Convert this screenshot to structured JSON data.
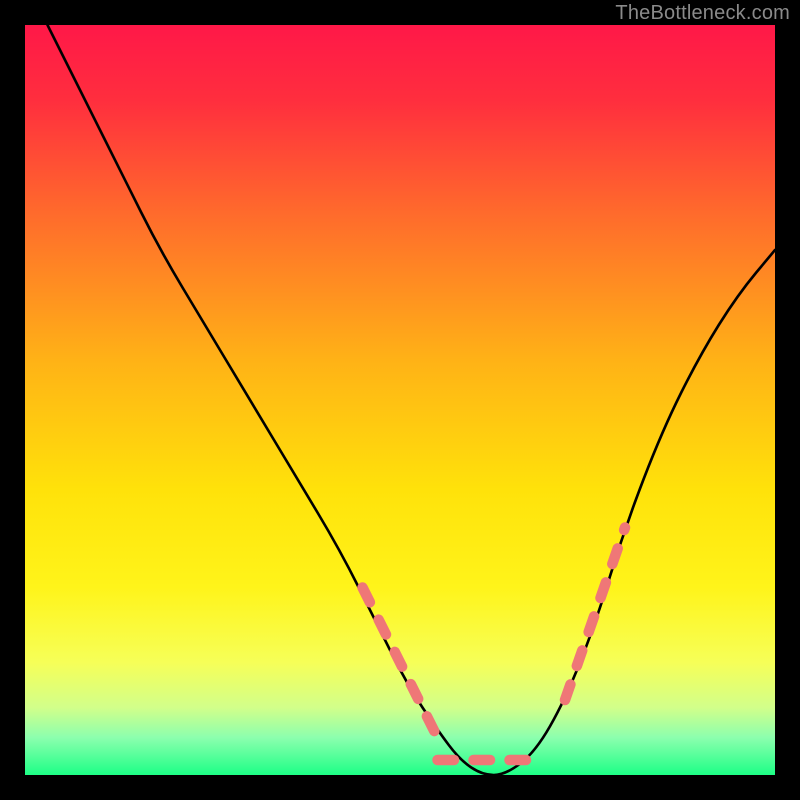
{
  "attribution": "TheBottleneck.com",
  "colors": {
    "background": "#000000",
    "gradient_stops": [
      {
        "pct": 0,
        "color": "#ff1848"
      },
      {
        "pct": 10,
        "color": "#ff2e3e"
      },
      {
        "pct": 25,
        "color": "#ff6a2c"
      },
      {
        "pct": 45,
        "color": "#ffb316"
      },
      {
        "pct": 62,
        "color": "#ffe20a"
      },
      {
        "pct": 75,
        "color": "#fff41a"
      },
      {
        "pct": 85,
        "color": "#f6ff58"
      },
      {
        "pct": 91,
        "color": "#d2ff8a"
      },
      {
        "pct": 95,
        "color": "#8cffae"
      },
      {
        "pct": 100,
        "color": "#1dff86"
      }
    ],
    "curve": "#000000",
    "dash": "#ef7777"
  },
  "chart_data": {
    "type": "line",
    "title": "",
    "xlabel": "",
    "ylabel": "",
    "xlim": [
      0,
      100
    ],
    "ylim": [
      0,
      100
    ],
    "series": [
      {
        "name": "bottleneck-curve",
        "x": [
          3,
          8,
          13,
          18,
          24,
          30,
          36,
          42,
          47,
          51,
          55,
          58,
          61,
          64,
          68,
          72,
          76,
          80,
          85,
          90,
          95,
          100
        ],
        "y": [
          100,
          90,
          80,
          70,
          60,
          50,
          40,
          30,
          20,
          12,
          6,
          2,
          0,
          0,
          3,
          10,
          20,
          33,
          46,
          56,
          64,
          70
        ]
      }
    ],
    "dash_segments": {
      "left": {
        "x_range": [
          45,
          55
        ],
        "y_range": [
          25,
          5
        ]
      },
      "floor": {
        "x_range": [
          55,
          68
        ],
        "y_range": [
          2,
          2
        ]
      },
      "right": {
        "x_range": [
          72,
          80
        ],
        "y_range": [
          10,
          33
        ]
      }
    }
  }
}
